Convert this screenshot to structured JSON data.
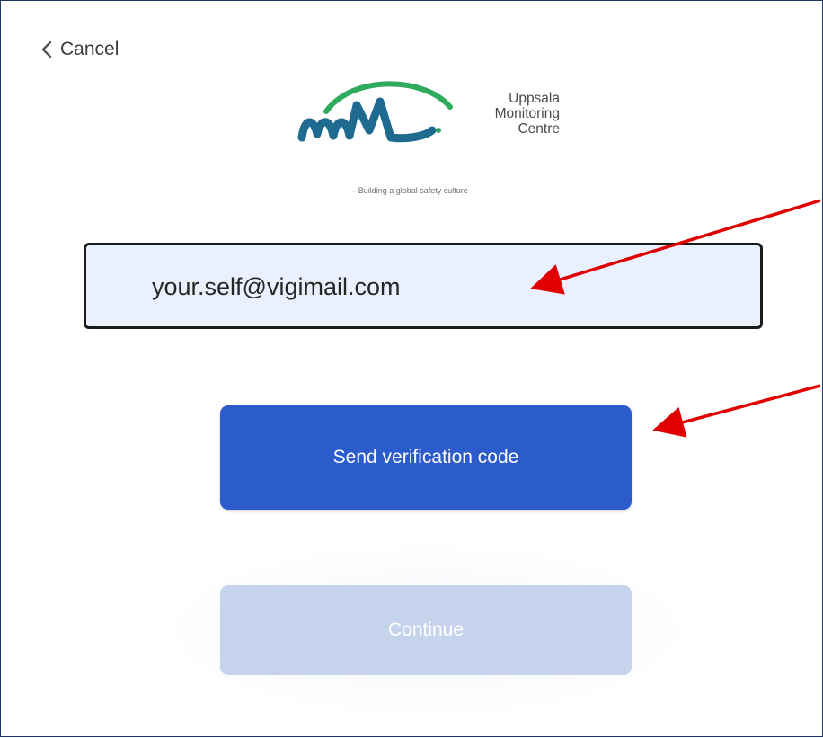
{
  "header": {
    "cancel_label": "Cancel"
  },
  "logo": {
    "name_line1": "Uppsala",
    "name_line2": "Monitoring",
    "name_line3": "Centre",
    "tagline": "– Building a global safety culture",
    "colors": {
      "arc": "#2eaa5c",
      "wave": "#1f6b8f"
    }
  },
  "email_field": {
    "value": "your.self@vigimail.com"
  },
  "buttons": {
    "send_label": "Send verification code",
    "continue_label": "Continue"
  },
  "colors": {
    "primary": "#2c5bcb",
    "disabled": "#c6d3ec",
    "input_bg": "#eaf0fd",
    "annotation_arrow": "#e00000"
  }
}
